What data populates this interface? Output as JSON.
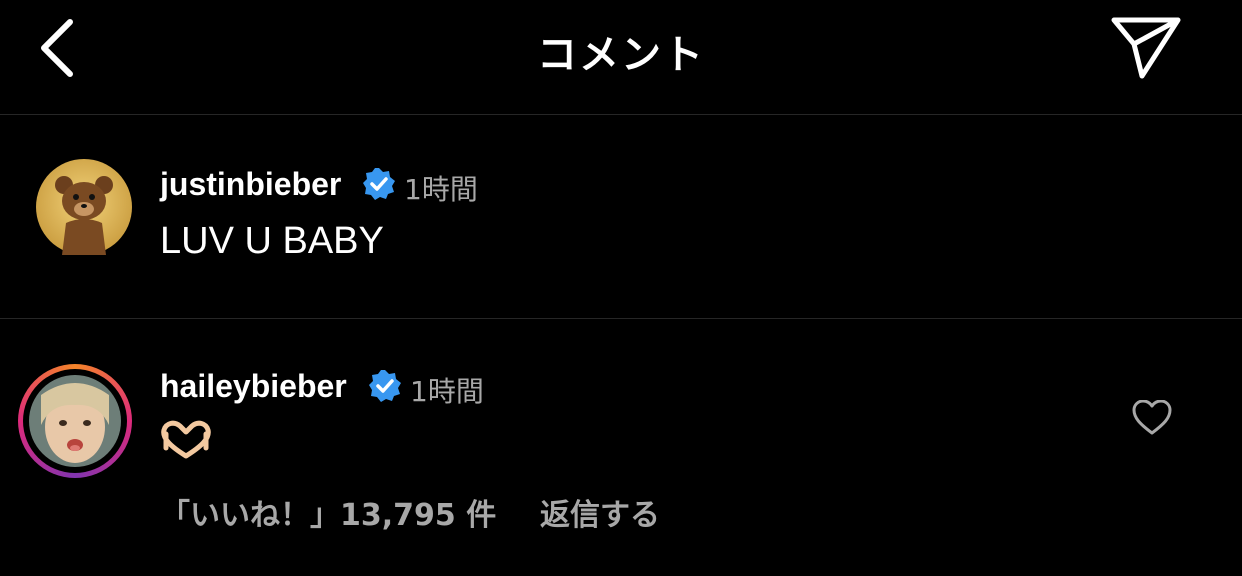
{
  "header": {
    "title": "コメント",
    "back_icon": "chevron-left-icon",
    "send_icon": "paper-plane-icon"
  },
  "comments": [
    {
      "username": "justinbieber",
      "verified": true,
      "time": "1時間",
      "text": "LUV U BABY",
      "avatar": "teddy-bear-avatar"
    },
    {
      "username": "haileybieber",
      "verified": true,
      "time": "1時間",
      "text_emoji": "heart-hands-emoji",
      "likes_label": "「いいね！」13,795 件",
      "reply_label": "返信する",
      "avatar": "child-photo-avatar",
      "story_ring": true
    }
  ],
  "colors": {
    "background": "#000000",
    "divider": "#262626",
    "secondary_text": "#a8a8a8",
    "verified_blue": "#3897f0"
  }
}
